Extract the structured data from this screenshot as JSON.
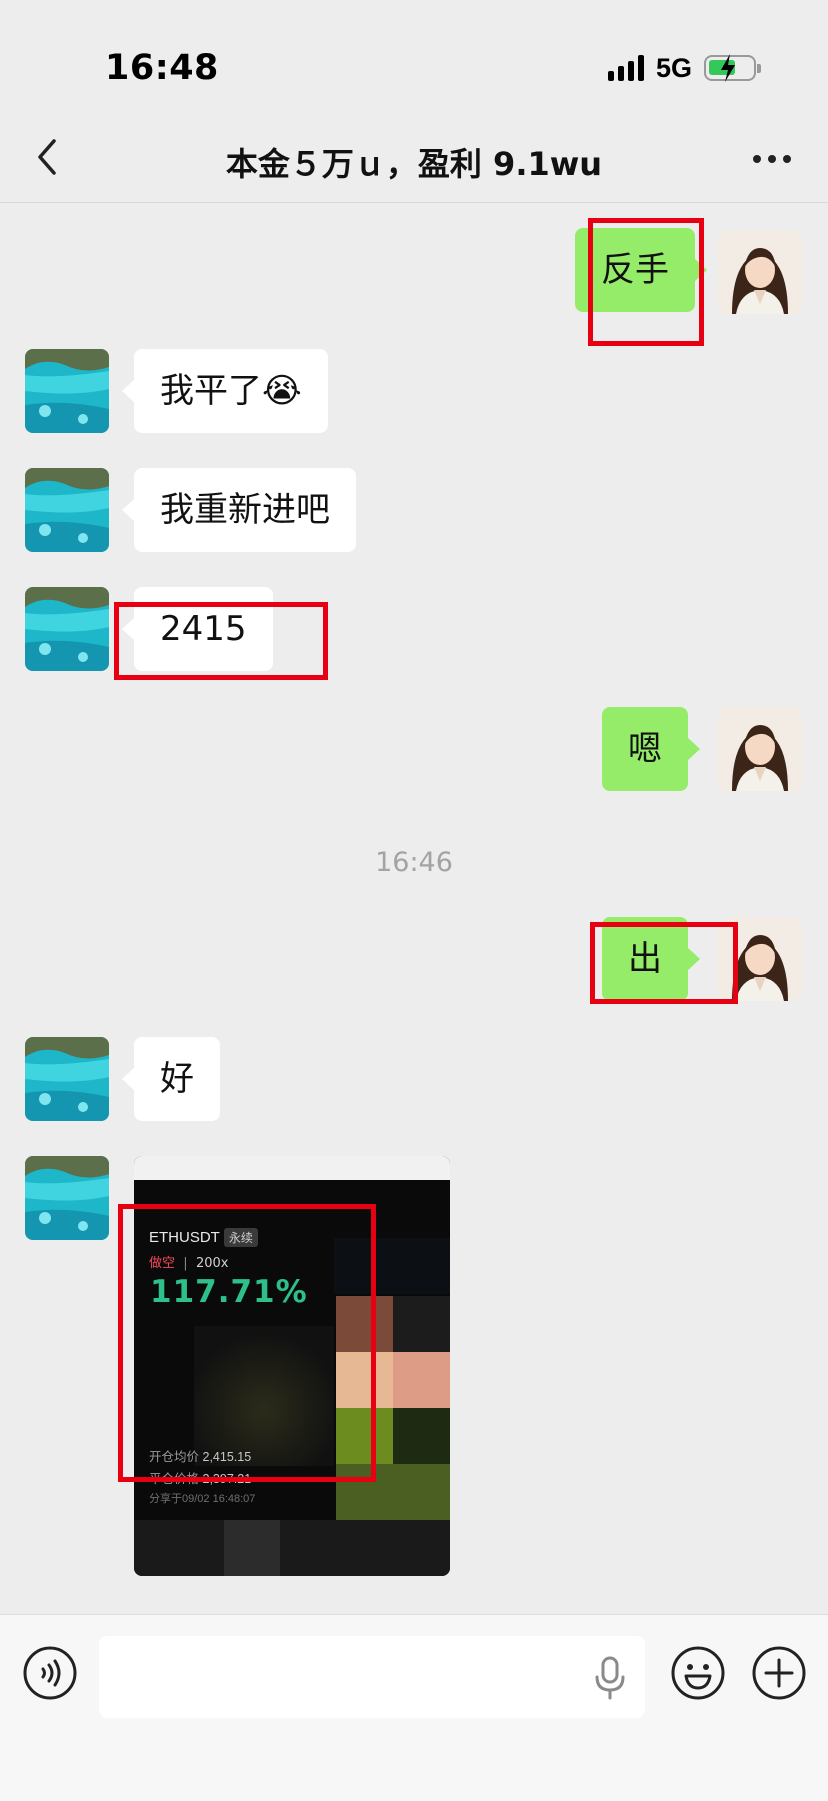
{
  "status_bar": {
    "time": "16:48",
    "network": "5G"
  },
  "header": {
    "title": "本金５万ｕ，盈利 9.1wu"
  },
  "messages": {
    "m1": "反手",
    "m2": "我平了😭",
    "m3": "我重新进吧",
    "m4": "2415",
    "m5": "嗯",
    "timestamp": "16:46",
    "m6": "出",
    "m7": "好"
  },
  "trade_card": {
    "pair": "ETHUSDT",
    "contract_tag": "永续",
    "side": "做空",
    "leverage": "200x",
    "pnl_percent": "117.71%",
    "open_label": "开仓均价",
    "open_price": "2,415.15",
    "close_label": "平仓价格",
    "close_price": "2,397.21",
    "share_label": "分享于",
    "share_time": "09/02 16:48:07"
  },
  "colors": {
    "background": "#ededed",
    "outgoing_bubble": "#95ec69",
    "incoming_bubble": "#ffffff",
    "highlight": "#e60012",
    "pnl": "#2ec08a"
  }
}
